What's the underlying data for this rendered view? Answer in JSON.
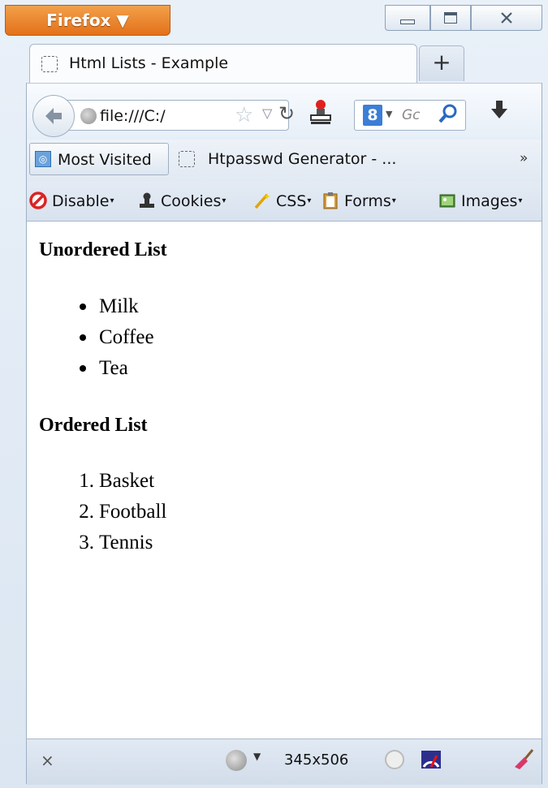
{
  "titlebar": {
    "app_menu_label": "Firefox ▼"
  },
  "tab": {
    "title": "Html Lists - Example",
    "new_tab_label": "+"
  },
  "navbar": {
    "url": "file:///C:/",
    "search_placeholder": "Gc",
    "search_engine_letter": "8"
  },
  "bookmarks": {
    "most_visited": "Most Visited",
    "item2": "Htpasswd Generator - ...",
    "overflow": "»"
  },
  "devbar": {
    "disable": "Disable",
    "cookies": "Cookies",
    "css": "CSS",
    "forms": "Forms",
    "images": "Images"
  },
  "content": {
    "unordered_heading": "Unordered List",
    "unordered_items": [
      "Milk",
      "Coffee",
      "Tea"
    ],
    "ordered_heading": "Ordered List",
    "ordered_items": [
      "Basket",
      "Football",
      "Tennis"
    ],
    "ordered_numbers": [
      "1.",
      "2.",
      "3."
    ]
  },
  "statusbar": {
    "close": "×",
    "size": "345x506"
  },
  "colors": {
    "firefox_orange": "#e3711a",
    "chrome_blue": "#dbe6f2"
  }
}
